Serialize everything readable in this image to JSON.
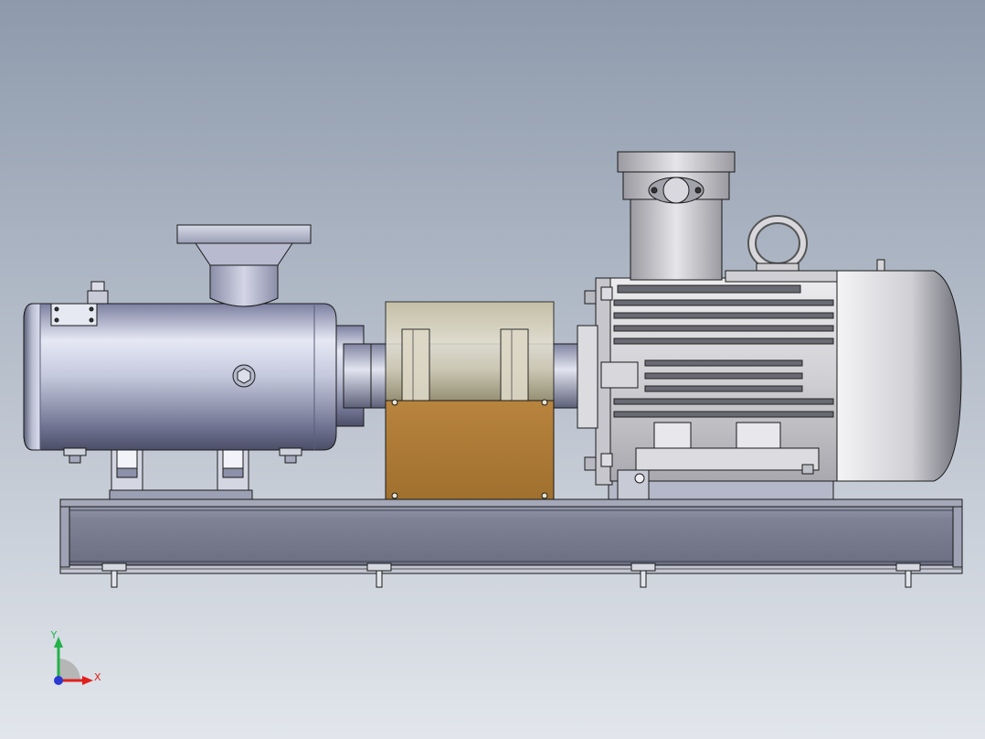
{
  "viewport": {
    "background_top": "#8e9aac",
    "background_bottom": "#e2e6ec"
  },
  "triad": {
    "x_label": "X",
    "y_label": "Y",
    "x_color": "#e0201c",
    "y_color": "#22b24a",
    "z_color": "#2a3ad0"
  },
  "model": {
    "pump_body_color": "#c4c8dc",
    "coupling_guard_color": "#a8773c",
    "motor_color": "#d6d6d8",
    "base_color": "#7e8294",
    "line_color": "#1a1a1a"
  }
}
